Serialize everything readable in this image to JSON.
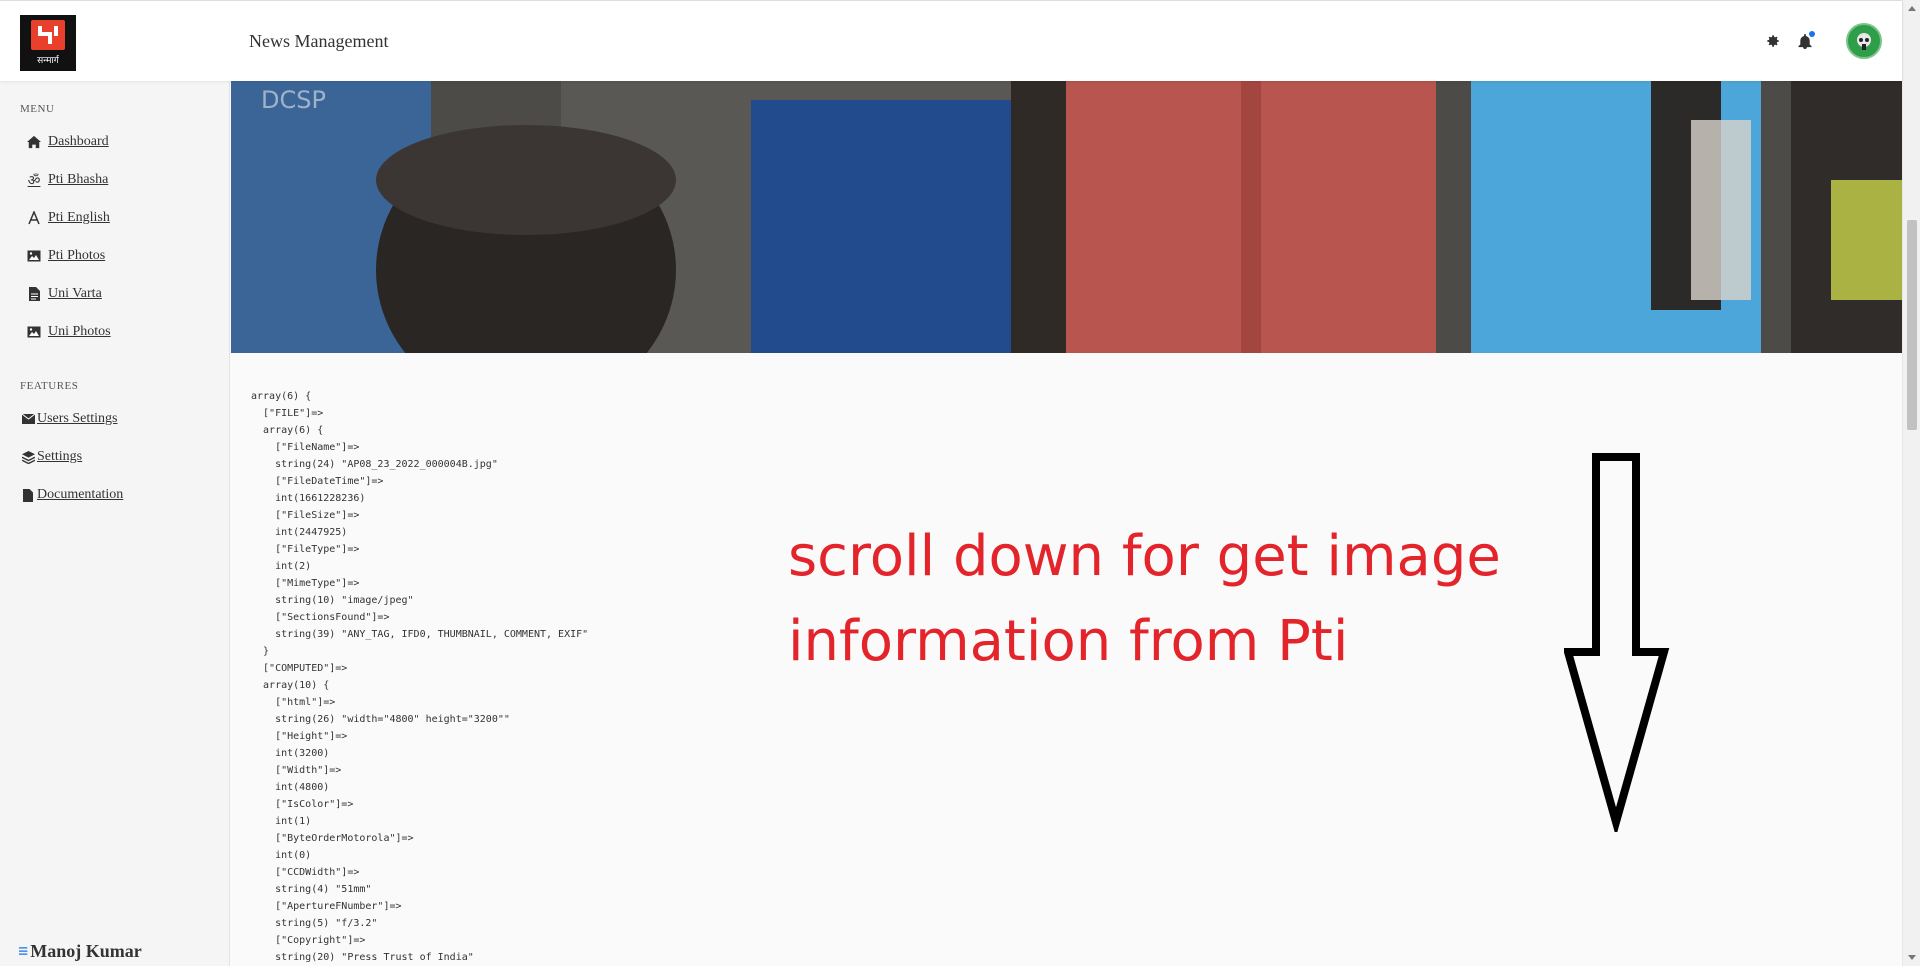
{
  "header": {
    "logo_text": "सन्मार्ग",
    "title": "News Management"
  },
  "sidebar": {
    "menu_heading": "MENU",
    "menu_items": [
      {
        "label": "Dashboard",
        "icon": "home-icon"
      },
      {
        "label": "Pti Bhasha",
        "icon": "om-icon"
      },
      {
        "label": "Pti English",
        "icon": "letter-a-icon"
      },
      {
        "label": "Pti Photos",
        "icon": "image-icon"
      },
      {
        "label": "Uni Varta",
        "icon": "file-icon"
      },
      {
        "label": "Uni Photos",
        "icon": "image-icon"
      }
    ],
    "features_heading": "FEATURES",
    "feature_items": [
      {
        "label": "Users Settings",
        "icon": "envelope-icon"
      },
      {
        "label": "Settings",
        "icon": "layers-icon"
      },
      {
        "label": "Documentation",
        "icon": "document-icon"
      }
    ],
    "user_name": "Manoj Kumar"
  },
  "main": {
    "dump_lines": [
      "array(6) {",
      "  [\"FILE\"]=>",
      "  array(6) {",
      "    [\"FileName\"]=>",
      "    string(24) \"AP08_23_2022_000004B.jpg\"",
      "    [\"FileDateTime\"]=>",
      "    int(1661228236)",
      "    [\"FileSize\"]=>",
      "    int(2447925)",
      "    [\"FileType\"]=>",
      "    int(2)",
      "    [\"MimeType\"]=>",
      "    string(10) \"image/jpeg\"",
      "    [\"SectionsFound\"]=>",
      "    string(39) \"ANY_TAG, IFD0, THUMBNAIL, COMMENT, EXIF\"",
      "  }",
      "  [\"COMPUTED\"]=>",
      "  array(10) {",
      "    [\"html\"]=>",
      "    string(26) \"width=\"4800\" height=\"3200\"\"",
      "    [\"Height\"]=>",
      "    int(3200)",
      "    [\"Width\"]=>",
      "    int(4800)",
      "    [\"IsColor\"]=>",
      "    int(1)",
      "    [\"ByteOrderMotorola\"]=>",
      "    int(0)",
      "    [\"CCDWidth\"]=>",
      "    string(4) \"51mm\"",
      "    [\"ApertureFNumber\"]=>",
      "    string(5) \"f/3.2\"",
      "    [\"Copyright\"]=>",
      "    string(20) \"Press Trust of India\""
    ],
    "annotation_line1": "scroll down for get image",
    "annotation_line2": "information from Pti",
    "accent_color": "#e3242b"
  }
}
